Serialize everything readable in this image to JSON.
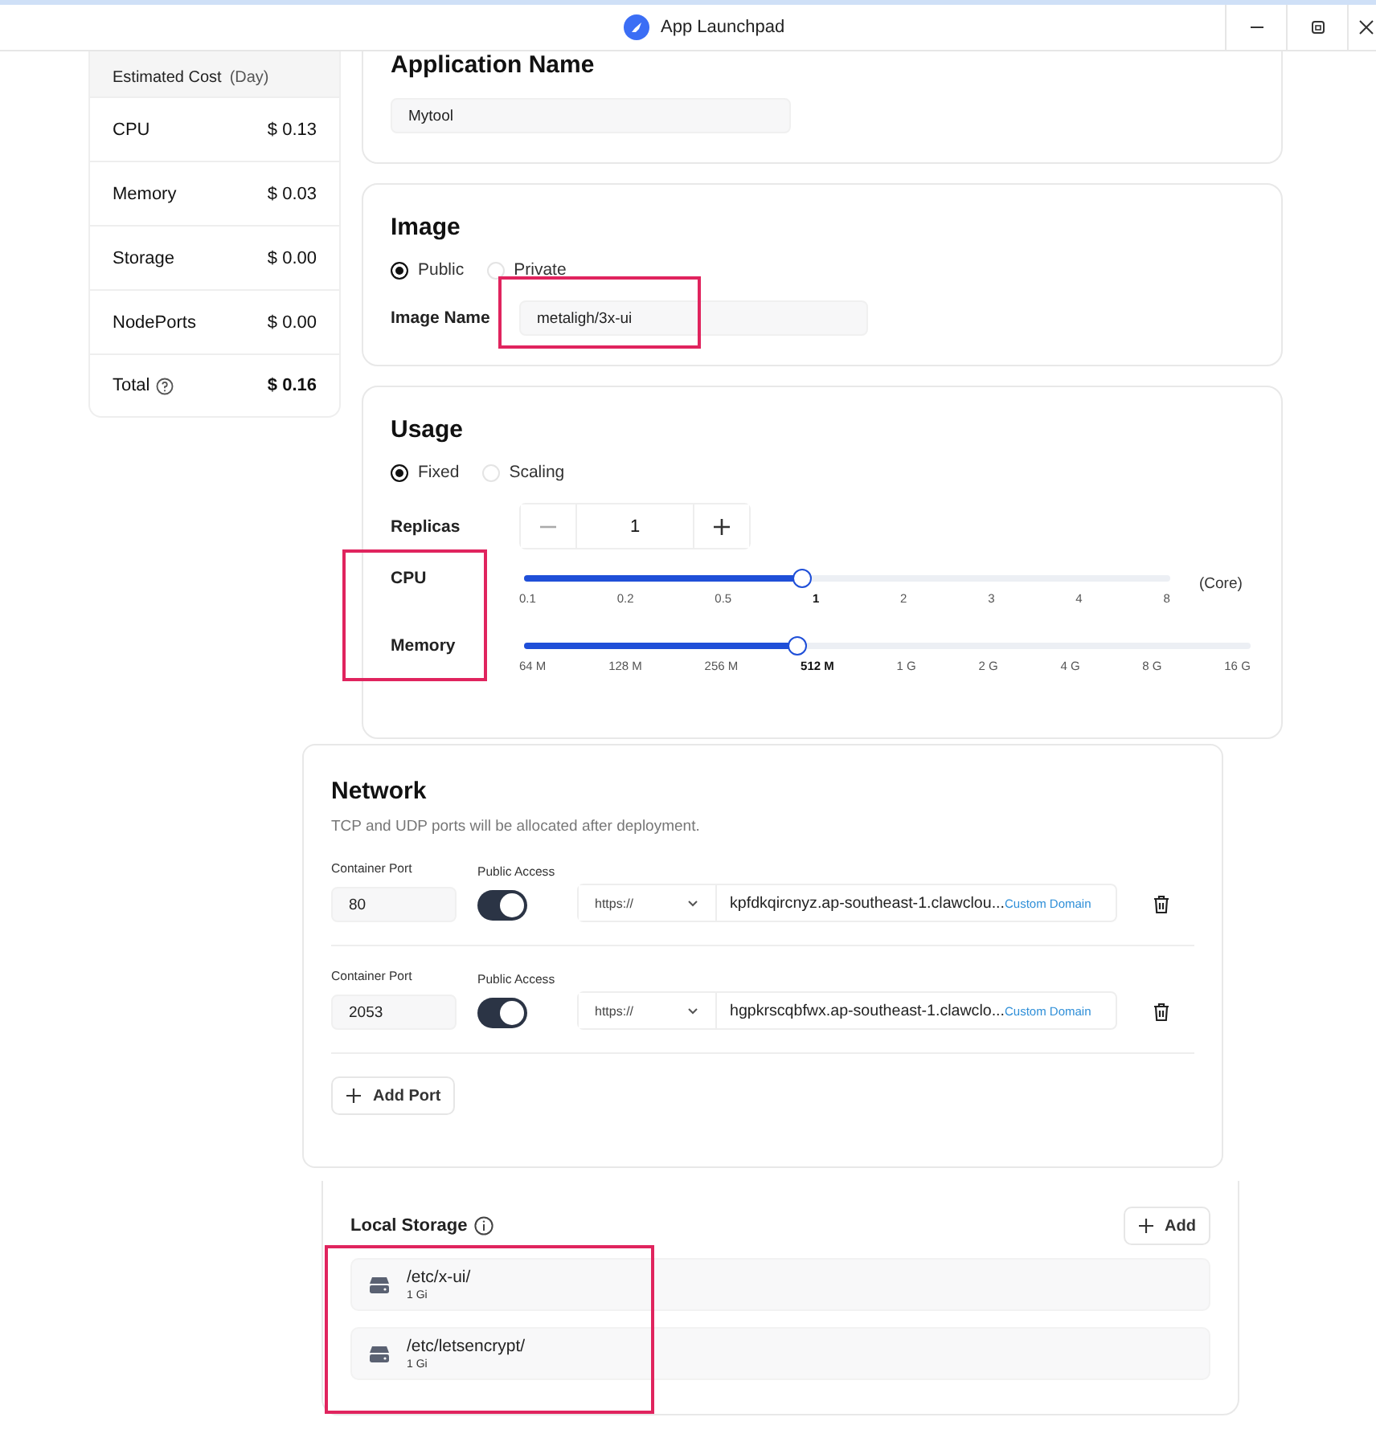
{
  "window": {
    "title": "App Launchpad"
  },
  "cost": {
    "title": "Estimated Cost",
    "unit": "(Day)",
    "rows": [
      {
        "label": "CPU",
        "value": "$ 0.13"
      },
      {
        "label": "Memory",
        "value": "$ 0.03"
      },
      {
        "label": "Storage",
        "value": "$ 0.00"
      },
      {
        "label": "NodePorts",
        "value": "$ 0.00"
      }
    ],
    "total": {
      "label": "Total",
      "value": "$ 0.16"
    }
  },
  "app_name": {
    "title": "Application Name",
    "value": "Mytool"
  },
  "image": {
    "title": "Image",
    "options": [
      {
        "label": "Public",
        "selected": true
      },
      {
        "label": "Private",
        "selected": false
      }
    ],
    "name_label": "Image Name",
    "name_value": "metaligh/3x-ui"
  },
  "usage": {
    "title": "Usage",
    "options": [
      {
        "label": "Fixed",
        "selected": true
      },
      {
        "label": "Scaling",
        "selected": false
      }
    ],
    "replicas_label": "Replicas",
    "replicas": "1",
    "cpu": {
      "label": "CPU",
      "level": 0.43,
      "unit": "(Core)",
      "ticks": [
        {
          "label": "0.1",
          "selected": false
        },
        {
          "label": "0.2",
          "selected": false
        },
        {
          "label": "0.5",
          "selected": false
        },
        {
          "label": "1",
          "selected": true
        },
        {
          "label": "2",
          "selected": false
        },
        {
          "label": "3",
          "selected": false
        },
        {
          "label": "4",
          "selected": false
        },
        {
          "label": "8",
          "selected": false
        }
      ]
    },
    "memory": {
      "label": "Memory",
      "level": 0.375,
      "ticks": [
        {
          "label": "64 M",
          "selected": false
        },
        {
          "label": "128 M",
          "selected": false
        },
        {
          "label": "256 M",
          "selected": false
        },
        {
          "label": "512 M",
          "selected": true
        },
        {
          "label": "1 G",
          "selected": false
        },
        {
          "label": "2 G",
          "selected": false
        },
        {
          "label": "4 G",
          "selected": false
        },
        {
          "label": "8 G",
          "selected": false
        },
        {
          "label": "16 G",
          "selected": false
        }
      ]
    }
  },
  "network": {
    "title": "Network",
    "note": "TCP and UDP ports will be allocated after deployment.",
    "ports": [
      {
        "port_label": "Container Port",
        "port": "80",
        "access_label": "Public Access",
        "public_access": true,
        "protocol": "https://",
        "domain": "kpfdkqircnyz.ap-southeast-1.clawclou...",
        "custom_domain": "Custom Domain"
      },
      {
        "port_label": "Container Port",
        "port": "2053",
        "access_label": "Public Access",
        "public_access": true,
        "protocol": "https://",
        "domain": "hgpkrscqbfwx.ap-southeast-1.clawclo...",
        "custom_domain": "Custom Domain"
      }
    ],
    "add_port": "Add Port"
  },
  "storage": {
    "title": "Local Storage",
    "add": "Add",
    "items": [
      {
        "path": "/etc/x-ui/",
        "size": "1 Gi"
      },
      {
        "path": "/etc/letsencrypt/",
        "size": "1 Gi"
      }
    ]
  }
}
